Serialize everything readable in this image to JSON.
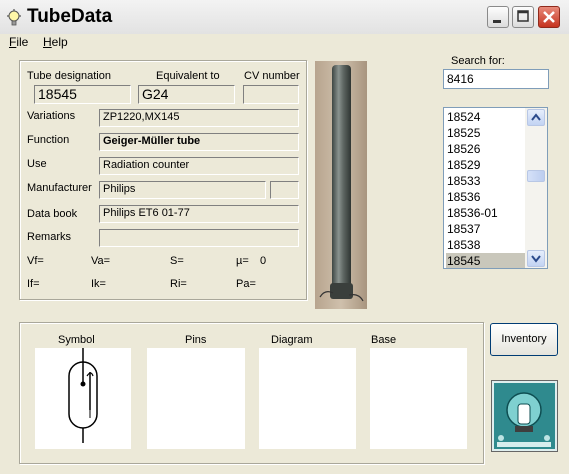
{
  "window": {
    "title": "TubeData"
  },
  "menu": {
    "file": "File",
    "help": "Help"
  },
  "fields": {
    "tube_designation_label": "Tube designation",
    "tube_designation": "18545",
    "equivalent_label": "Equivalent to",
    "equivalent": "G24",
    "cv_label": "CV number",
    "cv": "",
    "variations_label": "Variations",
    "variations": "ZP1220,MX145",
    "function_label": "Function",
    "function": "Geiger-Müller tube",
    "use_label": "Use",
    "use": "Radiation counter",
    "manufacturer_label": "Manufacturer",
    "manufacturer": "Philips",
    "manufacturer_extra": "",
    "databook_label": "Data book",
    "databook": "Philips ET6  01-77",
    "remarks_label": "Remarks",
    "remarks": ""
  },
  "params": {
    "vf": "Vf=",
    "va": "Va=",
    "s": "S=",
    "mu": "µ=",
    "mu_value": "0",
    "if": "If=",
    "ik": "Ik=",
    "ri": "Ri=",
    "pa": "Pa="
  },
  "search": {
    "label": "Search for:",
    "value": "8416"
  },
  "list": {
    "items": [
      "18524",
      "18525",
      "18526",
      "18529",
      "18533",
      "18536",
      "18536-01",
      "18537",
      "18538",
      "18545"
    ],
    "selected": "18545"
  },
  "bottom": {
    "symbol": "Symbol",
    "pins": "Pins",
    "diagram": "Diagram",
    "base": "Base"
  },
  "buttons": {
    "inventory": "Inventory"
  },
  "colors": {
    "selection": "#c9c7bb",
    "accent_close": "#c5331f",
    "window_bg": "#ece9d8"
  }
}
